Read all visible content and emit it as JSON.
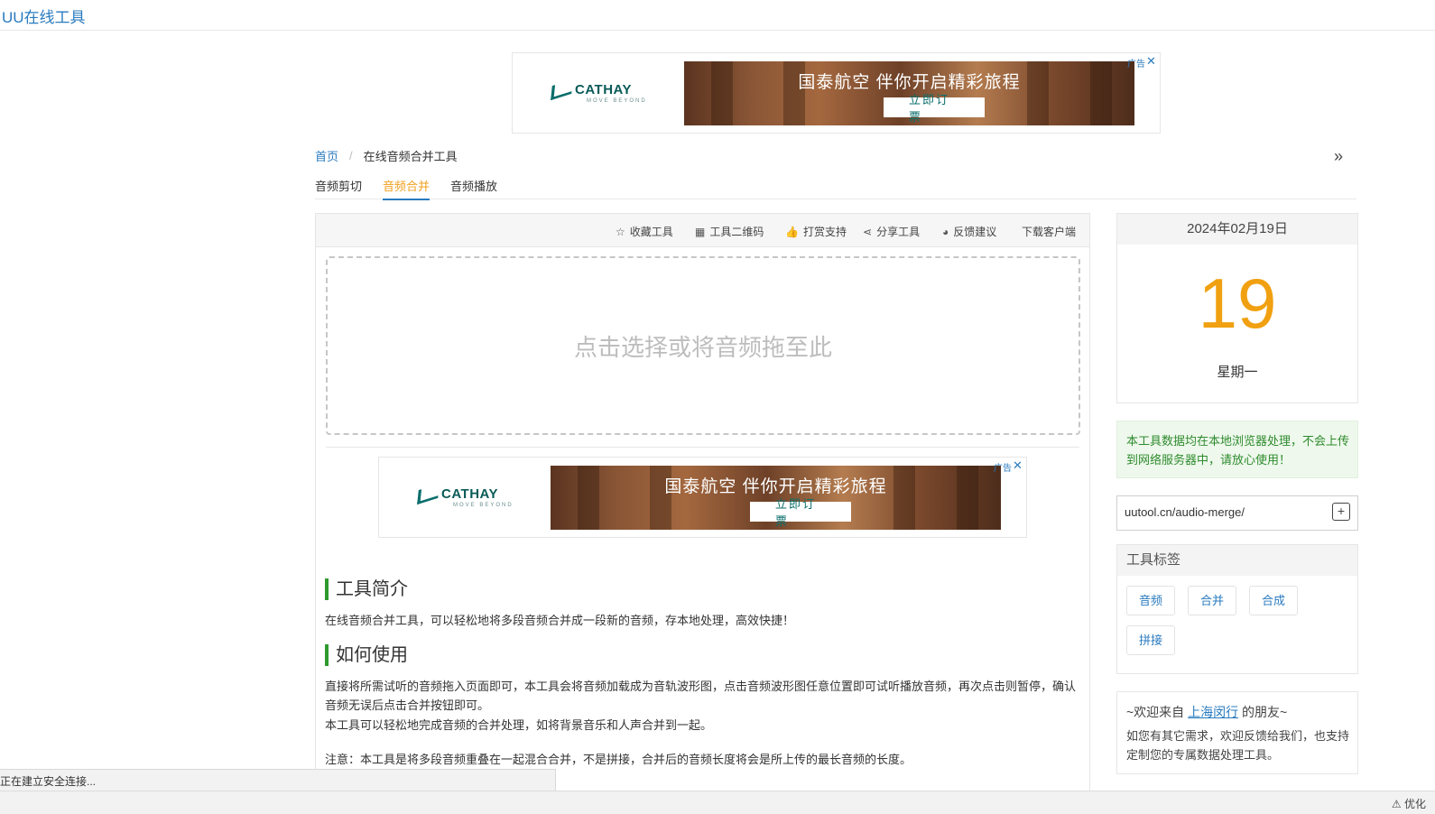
{
  "site": {
    "title": "UU在线工具"
  },
  "ads": [
    {
      "headline": "国泰航空 伴你开启精彩旅程",
      "cta": "立即订票",
      "label": "广告",
      "close": "✕",
      "brand": "CATHAY",
      "tagline": "MOVE BEYOND"
    },
    {
      "headline": "国泰航空 伴你开启精彩旅程",
      "cta": "立即订票",
      "label": "广告",
      "close": "✕",
      "brand": "CATHAY",
      "tagline": "MOVE BEYOND"
    }
  ],
  "breadcrumb": {
    "home": "首页",
    "separator": "/",
    "current": "在线音频合并工具"
  },
  "tabs": [
    {
      "label": "音频剪切"
    },
    {
      "label": "音频合并",
      "active": true
    },
    {
      "label": "音频播放"
    }
  ],
  "toolbar": {
    "favorite": "收藏工具",
    "qrcode": "工具二维码",
    "donate": "打赏支持",
    "share": "分享工具",
    "feedback": "反馈建议",
    "download": "下载客户端"
  },
  "dropzone": {
    "text": "点击选择或将音频拖至此"
  },
  "intro": {
    "heading": "工具简介",
    "text": "在线音频合并工具，可以轻松地将多段音频合并成一段新的音频，存本地处理，高效快捷！"
  },
  "howto": {
    "heading": "如何使用",
    "p1": "直接将所需试听的音频拖入页面即可，本工具会将音频加载成为音轨波形图，点击音频波形图任意位置即可试听播放音频，再次点击则暂停，确认音频无误后点击合并按钮即可。",
    "p2": "本工具可以轻松地完成音频的合并处理，如将背景音乐和人声合并到一起。",
    "note": "注意：本工具是将多段音频重叠在一起混合合并，不是拼接，合并后的音频长度将会是所上传的最长音频的长度。"
  },
  "calendar": {
    "date": "2024年02月19日",
    "day": "19",
    "weekday": "星期一"
  },
  "notice": {
    "text": "本工具数据均在本地浏览器处理，不会上传到网络服务器中，请放心使用！"
  },
  "url": {
    "value": "uutool.cn/audio-merge/"
  },
  "tag_section": {
    "title": "工具标签",
    "tags": [
      "音频",
      "合并",
      "合成",
      "拼接"
    ]
  },
  "welcome": {
    "prefix": "~欢迎来自",
    "location": "上海闵行",
    "suffix": "的朋友~",
    "text": "如您有其它需求，欢迎反馈给我们，也支持定制您的专属数据处理工具。"
  },
  "status": {
    "text": "正在建立安全连接...",
    "optimize": "优化"
  },
  "colors": {
    "accent": "#2a7bbf",
    "active_tab": "#f0a020",
    "day_number": "#f0a010",
    "section_bar": "#2e9a2e"
  }
}
